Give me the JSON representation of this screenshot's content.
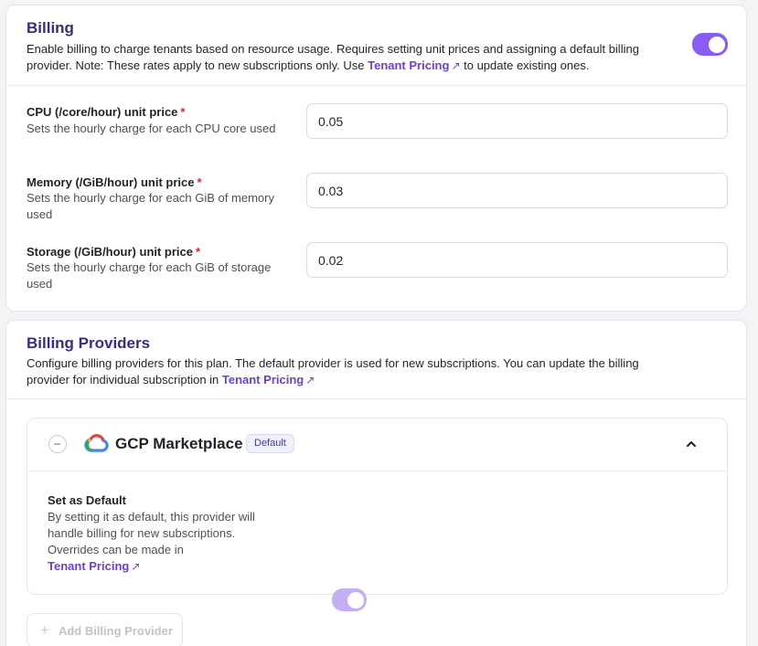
{
  "billing": {
    "title": "Billing",
    "description_part1": "Enable billing to charge tenants based on resource usage. Requires setting unit prices and assigning a default billing provider. Note: These rates apply to new subscriptions only. Use",
    "description_link": "Tenant Pricing",
    "description_part2": "to update existing ones.",
    "enabled": true,
    "fields": [
      {
        "label": "CPU (/core/hour) unit price",
        "help": "Sets the hourly charge for each CPU core used",
        "value": "0.05"
      },
      {
        "label": "Memory (/GiB/hour) unit price",
        "help": "Sets the hourly charge for each GiB of memory used",
        "value": "0.03"
      },
      {
        "label": "Storage (/GiB/hour) unit price",
        "help": "Sets the hourly charge for each GiB of storage used",
        "value": "0.02"
      }
    ],
    "required_marker": "*"
  },
  "providers": {
    "title": "Billing Providers",
    "description_part1": "Configure billing providers for this plan. The default provider is used for new subscriptions. You can update the billing provider for individual subscription in",
    "description_link": "Tenant Pricing",
    "items": [
      {
        "name": "GCP Marketplace",
        "badge": "Default",
        "icon": "google-cloud-icon",
        "set_default_label": "Set as Default",
        "set_default_help": "By setting it as default, this provider will handle billing for new subscriptions. Overrides can be made in",
        "help_link": "Tenant Pricing",
        "is_default": true
      }
    ],
    "add_button_label": "Add Billing Provider"
  },
  "colors": {
    "accent": "#8a5cf6",
    "accent_light": "#c4aef4",
    "title": "#3b2a86",
    "link": "#6b3fd4",
    "required": "#d62424"
  },
  "arrow_glyph": "↗"
}
